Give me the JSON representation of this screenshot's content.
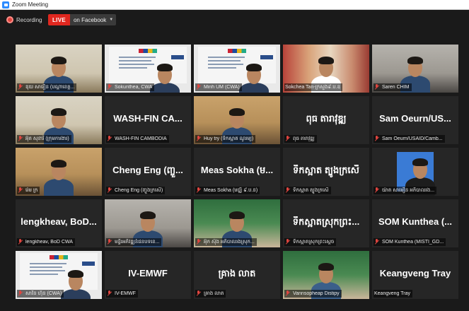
{
  "window": {
    "title": "Zoom Meeting"
  },
  "status": {
    "recording_label": "Recording",
    "live_badge": "LIVE",
    "live_target": "on Facebook"
  },
  "colors": {
    "live_red": "#e0271f",
    "active_speaker_border": "#d6e04a",
    "muted_mic": "#e0453f",
    "background": "#1a1a1a"
  },
  "participants": [
    {
      "name": "ឌុយ សារឿន (បណ្តាខេត្ត...",
      "video": true,
      "muted": true
    },
    {
      "name": "Sokunthea, CWA",
      "video": true,
      "muted": true
    },
    {
      "name": "Minh UM (CWA)",
      "video": true,
      "muted": true
    },
    {
      "name": "Sokchea Tan-ក្រសួង៩.ប.ឧ",
      "video": true,
      "muted": false,
      "active": true
    },
    {
      "name": "Saren CHIM",
      "video": true,
      "muted": true
    },
    {
      "name": "អ៊ុត សុខារី (ក្រុមការងារ)",
      "video": true,
      "muted": true
    },
    {
      "name": "WASH-FIN CAMBODIA",
      "display": "WASH-FIN CA...",
      "video": false,
      "muted": true
    },
    {
      "name": "Huy try (ទឹកស្អាត ណូរម្យ)",
      "video": true,
      "muted": true
    },
    {
      "name": "ពុធ តារាវុឌ្ឍ",
      "display": "ពុធ តារាវុឌ្ឍ",
      "video": false,
      "muted": true
    },
    {
      "name": "Sam Oeurn/USAID/Camb...",
      "display": "Sam Oeurn/US...",
      "video": false,
      "muted": true
    },
    {
      "name": "រ៉េម ក្រ",
      "video": true,
      "muted": true
    },
    {
      "name": "Cheng Eng (ញ្ចួងក្រសើ)",
      "display": "Cheng Eng (ញ្ចួ...",
      "video": false,
      "muted": true
    },
    {
      "name": "Meas Sokha (មជ្ឈិ ៩.ប.ន)",
      "display": "Meas Sokha (ម...",
      "video": false,
      "muted": true
    },
    {
      "name": "ទឹកស្អាត ត្បូងក្រសើ",
      "display": "ទឹកស្អាត ត្បូងក្រសើ",
      "video": false,
      "muted": true
    },
    {
      "name": "យ៉ាត សាមឿន អភិបាលរង...",
      "video": true,
      "muted": true
    },
    {
      "name": "lengkheav, BoD CWA",
      "display": "lengkheav, BoD...",
      "video": false,
      "muted": true
    },
    {
      "name": "មន្ទីរអភិវឌ្ឍន៍ជនបទខេ...",
      "video": true,
      "muted": true
    },
    {
      "name": "អ៊ុក ស៊ុង អភិបាលរងស្រុក...",
      "video": true,
      "muted": true
    },
    {
      "name": "ទឹកស្អាតស្រុកព្រះស្តេច",
      "display": "ទឹកស្អាតស្រុកព្រះ...",
      "video": false,
      "muted": true
    },
    {
      "name": "SOM Kunthea (MISTI_GD...",
      "display": "SOM Kunthea (...",
      "video": false,
      "muted": true
    },
    {
      "name": "សាវិន ហ៊ុន (CWA)",
      "video": true,
      "muted": true
    },
    {
      "name": "IV-EMWF",
      "display": "IV-EMWF",
      "video": false,
      "muted": true
    },
    {
      "name": "គ្រាង លាត",
      "display": "គ្រាង លាត",
      "video": false,
      "muted": true
    },
    {
      "name": "Vannsopheap Distipy",
      "video": true,
      "muted": true
    },
    {
      "name": "Keangveng Tray",
      "display": "Keangveng Tray",
      "video": false,
      "muted": false
    }
  ]
}
